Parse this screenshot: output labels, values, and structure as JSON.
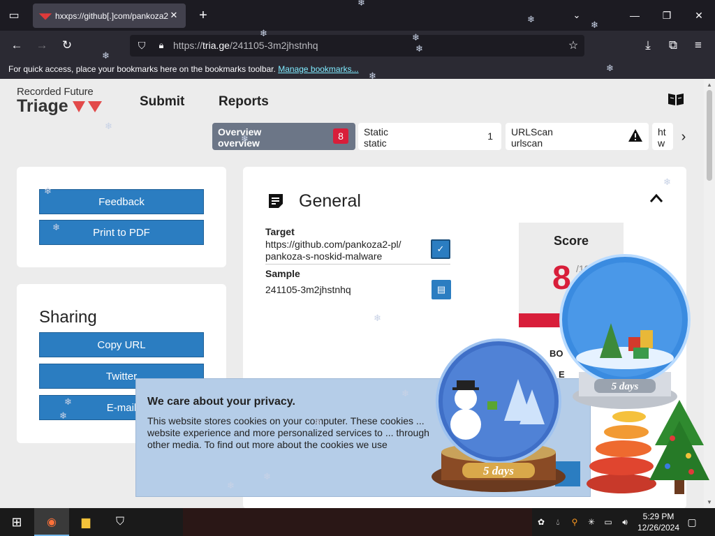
{
  "browser": {
    "tab_title": "hxxps://github[.]com/pankoza2",
    "url_prefix": "https://",
    "url_host": "tria.ge",
    "url_path": "/241105-3m2jhstnhq",
    "bookmarks_text": "For quick access, place your bookmarks here on the bookmarks toolbar.",
    "bookmarks_link": "Manage bookmarks..."
  },
  "header": {
    "logo_top": "Recorded Future",
    "logo_main": "Triage",
    "nav": [
      "Submit",
      "Reports"
    ]
  },
  "tabs": {
    "overview": {
      "line1": "Overview",
      "line2": "overview",
      "badge": "8"
    },
    "static": {
      "line1": "Static",
      "line2": "static",
      "count": "1"
    },
    "urlscan": {
      "line1": "URLScan",
      "line2": "urlscan"
    },
    "html": {
      "line1": "ht",
      "line2": "w"
    }
  },
  "left": {
    "feedback": "Feedback",
    "print": "Print to PDF",
    "sharing_title": "Sharing",
    "copy_url": "Copy URL",
    "twitter": "Twitter",
    "email": "E-mail"
  },
  "general": {
    "title": "General",
    "target_label": "Target",
    "target_line1": "https://github.com/pankoza2-pl/",
    "target_line2": "pankoza-s-noskid-malware",
    "sample_label": "Sample",
    "sample_value": "241105-3m2jhstnhq",
    "score_title": "Score",
    "score_value": "8",
    "score_max": "/10",
    "tag1": "BO",
    "tag2": "E_"
  },
  "privacy": {
    "title": "We care about your privacy.",
    "text": "This website stores cookies on your computer. These cookies ... website experience and more personalized services to ... through other media. To find out more about the cookies we use"
  },
  "decor": {
    "globe_label": "5 days"
  },
  "taskbar": {
    "time": "5:29 PM",
    "date": "12/26/2024"
  },
  "colors": {
    "accent_blue": "#2b7dc1",
    "danger_red": "#d81e3a",
    "chrome_dark": "#1c1b22",
    "tab_active": "#6c7687"
  }
}
